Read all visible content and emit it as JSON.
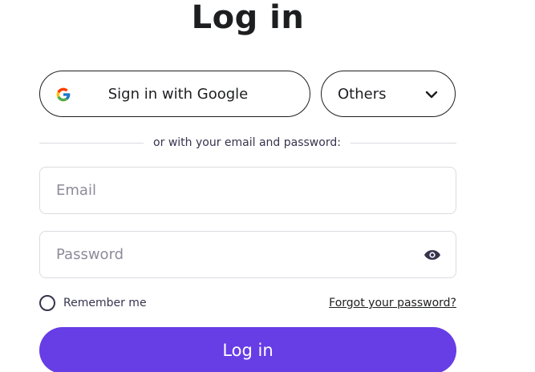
{
  "title": "Log in",
  "social": {
    "google_label": "Sign in with Google",
    "others_label": "Others"
  },
  "divider_text": "or with your email and password:",
  "form": {
    "email_placeholder": "Email",
    "password_placeholder": "Password",
    "remember_label": "Remember me",
    "forgot_label": "Forgot your password?",
    "submit_label": "Log in"
  },
  "icons": {
    "google": "google-g-icon",
    "others_chevron": "chevron-down-icon",
    "show_password": "eye-icon"
  },
  "colors": {
    "primary": "#673de6",
    "text": "#1d1e20",
    "border": "#dadce0"
  }
}
